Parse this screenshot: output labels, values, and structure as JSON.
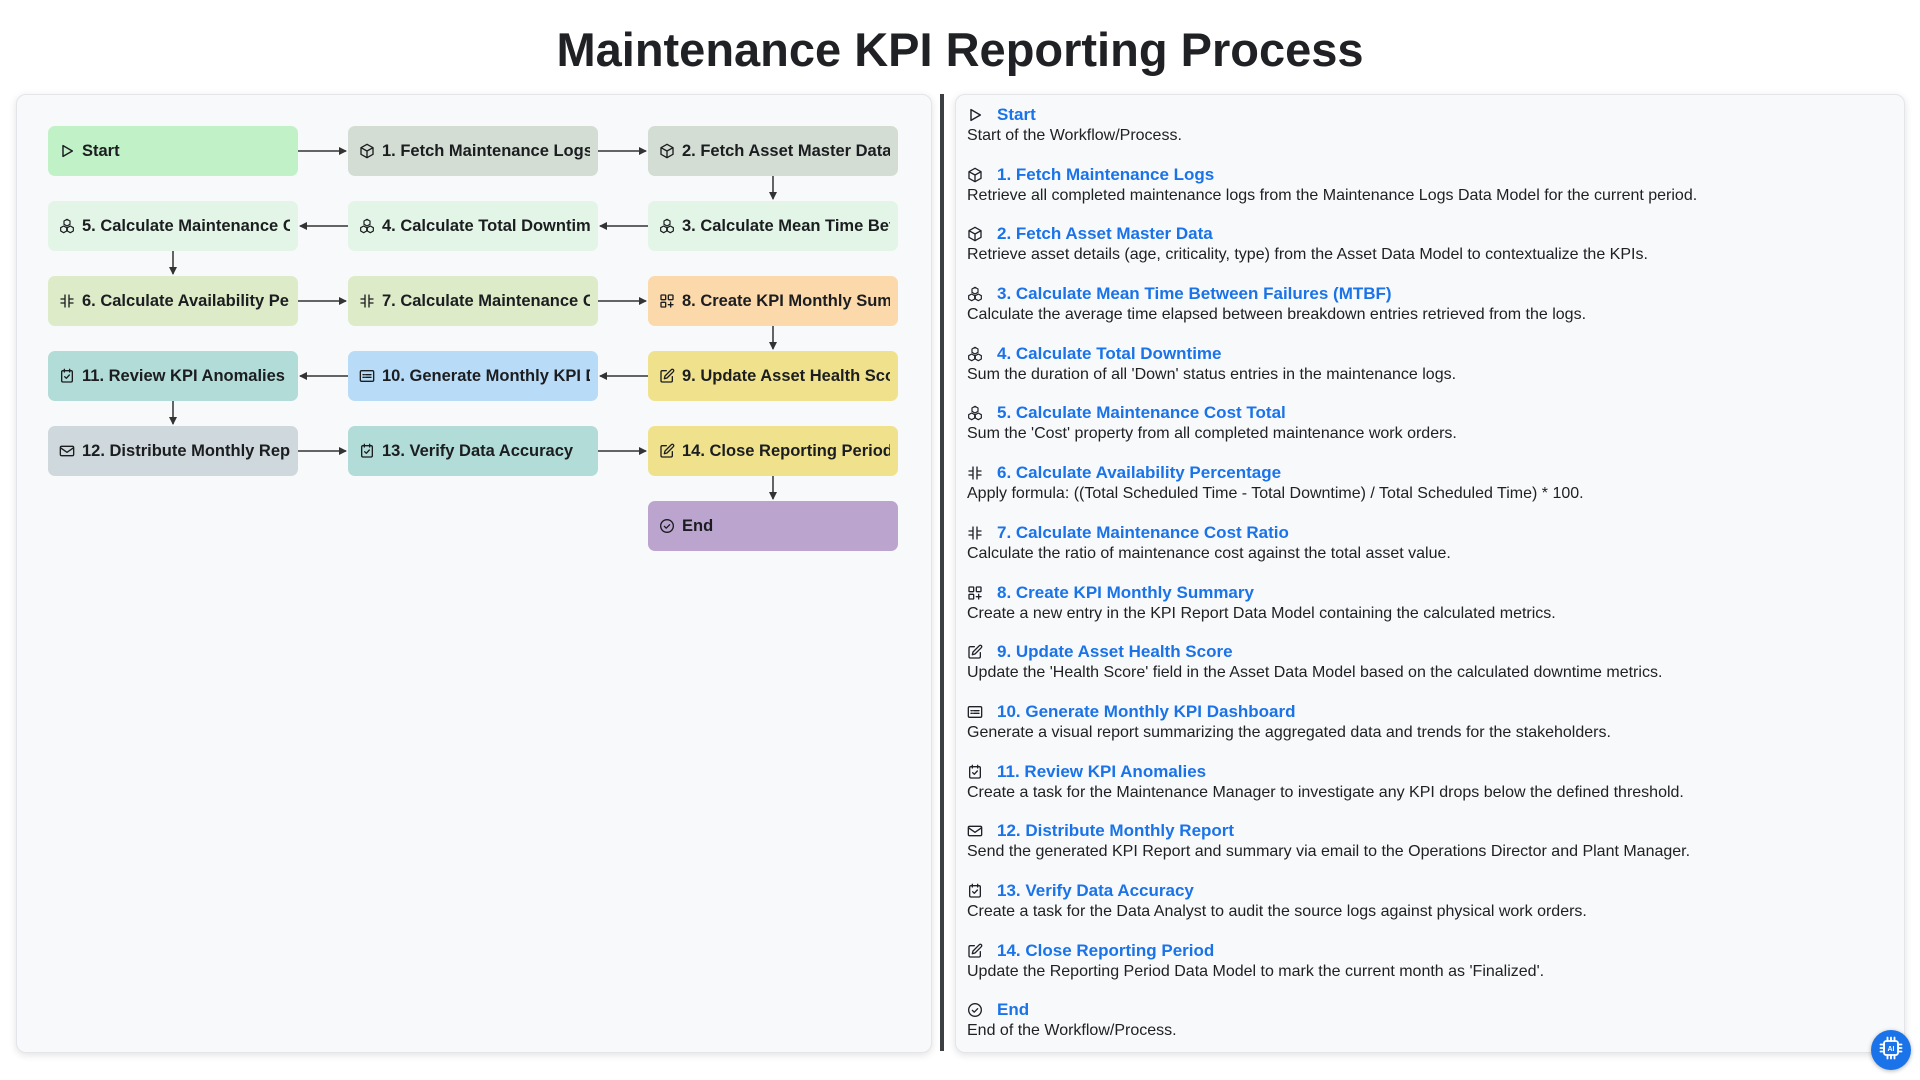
{
  "title": "Maintenance KPI Reporting Process",
  "colors": {
    "green": "#c1f2c7",
    "gray_green": "#d3ddd3",
    "mint": "#e2f5e6",
    "lime": "#ddebc8",
    "peach": "#fcd9aa",
    "yellow": "#f0e28d",
    "blue": "#b8dbf7",
    "teal": "#b2dcd7",
    "slate": "#cfd8dc",
    "purple": "#bba5cf",
    "link": "#1a73e8"
  },
  "flow": {
    "nodes": [
      {
        "id": "start",
        "label": "Start",
        "icon": "play-icon",
        "color": "#c1f2c7"
      },
      {
        "id": "n1",
        "label": "1. Fetch Maintenance Logs",
        "icon": "cube-icon",
        "color": "#d3ddd3"
      },
      {
        "id": "n2",
        "label": "2. Fetch Asset Master Data",
        "icon": "cube-icon",
        "color": "#d3ddd3"
      },
      {
        "id": "n3",
        "label": "3. Calculate Mean Time Bet",
        "icon": "cubes-icon",
        "color": "#e2f5e6"
      },
      {
        "id": "n4",
        "label": "4. Calculate Total Downtime",
        "icon": "cubes-icon",
        "color": "#e2f5e6"
      },
      {
        "id": "n5",
        "label": "5. Calculate Maintenance C",
        "icon": "cubes-icon",
        "color": "#e2f5e6"
      },
      {
        "id": "n6",
        "label": "6. Calculate Availability Per",
        "icon": "formula-icon",
        "color": "#ddebc8"
      },
      {
        "id": "n7",
        "label": "7. Calculate Maintenance C",
        "icon": "formula-icon",
        "color": "#ddebc8"
      },
      {
        "id": "n8",
        "label": "8. Create KPI Monthly Sum",
        "icon": "grid-plus-icon",
        "color": "#fcd9aa"
      },
      {
        "id": "n9",
        "label": "9. Update Asset Health Sco",
        "icon": "edit-icon",
        "color": "#f0e28d"
      },
      {
        "id": "n10",
        "label": "10. Generate Monthly KPI D",
        "icon": "dashboard-icon",
        "color": "#b8dbf7"
      },
      {
        "id": "n11",
        "label": "11. Review KPI Anomalies",
        "icon": "task-icon",
        "color": "#b2dcd7"
      },
      {
        "id": "n12",
        "label": "12. Distribute Monthly Repo",
        "icon": "mail-icon",
        "color": "#cfd8dc"
      },
      {
        "id": "n13",
        "label": "13. Verify Data Accuracy",
        "icon": "task-icon",
        "color": "#b2dcd7"
      },
      {
        "id": "n14",
        "label": "14. Close Reporting Period",
        "icon": "edit-icon",
        "color": "#f0e28d"
      },
      {
        "id": "end",
        "label": "End",
        "icon": "check-circle-icon",
        "color": "#bba5cf"
      }
    ]
  },
  "steps": [
    {
      "title": "Start",
      "desc": "Start of the Workflow/Process.",
      "icon": "play-icon"
    },
    {
      "title": "1. Fetch Maintenance Logs",
      "desc": "Retrieve all completed maintenance logs from the Maintenance Logs Data Model for the current period.",
      "icon": "cube-icon"
    },
    {
      "title": "2. Fetch Asset Master Data",
      "desc": "Retrieve asset details (age, criticality, type) from the Asset Data Model to contextualize the KPIs.",
      "icon": "cube-icon"
    },
    {
      "title": "3. Calculate Mean Time Between Failures (MTBF)",
      "desc": "Calculate the average time elapsed between breakdown entries retrieved from the logs.",
      "icon": "cubes-icon"
    },
    {
      "title": "4. Calculate Total Downtime",
      "desc": "Sum the duration of all 'Down' status entries in the maintenance logs.",
      "icon": "cubes-icon"
    },
    {
      "title": "5. Calculate Maintenance Cost Total",
      "desc": "Sum the 'Cost' property from all completed maintenance work orders.",
      "icon": "cubes-icon"
    },
    {
      "title": "6. Calculate Availability Percentage",
      "desc": "Apply formula: ((Total Scheduled Time - Total Downtime) / Total Scheduled Time) * 100.",
      "icon": "formula-icon"
    },
    {
      "title": "7. Calculate Maintenance Cost Ratio",
      "desc": "Calculate the ratio of maintenance cost against the total asset value.",
      "icon": "formula-icon"
    },
    {
      "title": "8. Create KPI Monthly Summary",
      "desc": "Create a new entry in the KPI Report Data Model containing the calculated metrics.",
      "icon": "grid-plus-icon"
    },
    {
      "title": "9. Update Asset Health Score",
      "desc": "Update the 'Health Score' field in the Asset Data Model based on the calculated downtime metrics.",
      "icon": "edit-icon"
    },
    {
      "title": "10. Generate Monthly KPI Dashboard",
      "desc": "Generate a visual report summarizing the aggregated data and trends for the stakeholders.",
      "icon": "dashboard-icon"
    },
    {
      "title": "11. Review KPI Anomalies",
      "desc": "Create a task for the Maintenance Manager to investigate any KPI drops below the defined threshold.",
      "icon": "task-icon"
    },
    {
      "title": "12. Distribute Monthly Report",
      "desc": "Send the generated KPI Report and summary via email to the Operations Director and Plant Manager.",
      "icon": "mail-icon"
    },
    {
      "title": "13. Verify Data Accuracy",
      "desc": "Create a task for the Data Analyst to audit the source logs against physical work orders.",
      "icon": "task-icon"
    },
    {
      "title": "14. Close Reporting Period",
      "desc": "Update the Reporting Period Data Model to mark the current month as 'Finalized'.",
      "icon": "edit-icon"
    },
    {
      "title": "End",
      "desc": "End of the Workflow/Process.",
      "icon": "check-circle-icon"
    }
  ],
  "fab": {
    "icon": "ai-chip-icon"
  }
}
